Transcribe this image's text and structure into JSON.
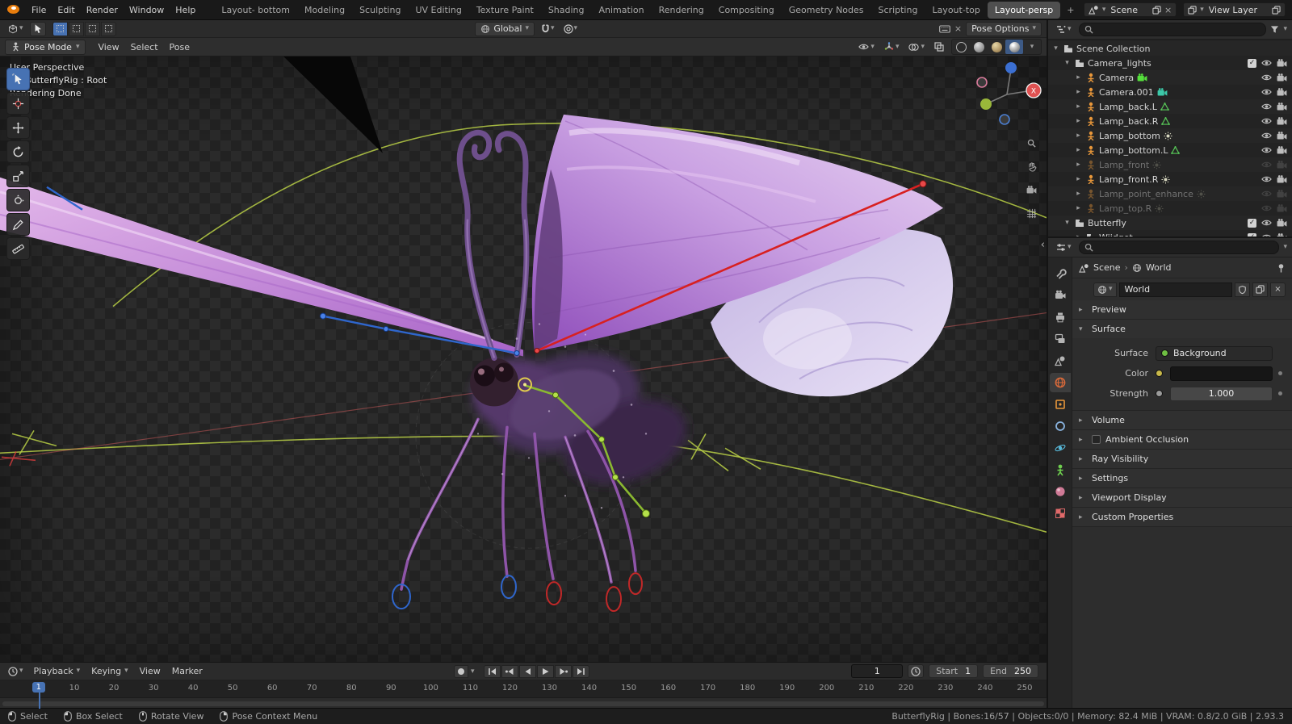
{
  "icons": {
    "dropdown": "▾",
    "disclosure_open": "▾",
    "disclosure_closed": "▸",
    "breadcrumb_separator": "›",
    "close": "×",
    "add": "+",
    "check": "✓",
    "sidebar_toggle": "‹"
  },
  "colors": {
    "accent": "#4772b3",
    "bone_red": "#d82020",
    "bone_blue": "#2f66cc",
    "bone_green": "#8ab830",
    "root_yellow": "#e0cb4e",
    "wing_purple": "#b57fd0",
    "ground_green": "#b8cf45"
  },
  "topbar": {
    "menus": [
      "File",
      "Edit",
      "Render",
      "Window",
      "Help"
    ],
    "workspaces": [
      "Layout- bottom",
      "Modeling",
      "Sculpting",
      "UV Editing",
      "Texture Paint",
      "Shading",
      "Animation",
      "Rendering",
      "Compositing",
      "Geometry Nodes",
      "Scripting",
      "Layout-top",
      "Layout-persp"
    ],
    "active_workspace": "Layout-persp",
    "scene_selector_label": "Scene",
    "view_layer_selector_label": "View Layer"
  },
  "tool_settings": {
    "orientation_label": "Global",
    "pose_options_label": "Pose Options",
    "select_modes": [
      "tweak",
      "box",
      "circle",
      "lasso"
    ]
  },
  "viewport_header": {
    "mode_label": "Pose Mode",
    "menus": [
      "View",
      "Select",
      "Pose"
    ]
  },
  "viewport": {
    "info_lines": [
      "User Perspective",
      "(1) ButterflyRig : Root",
      "Rendering Done"
    ],
    "gizmo": {
      "x_label": "X"
    },
    "tools": [
      {
        "name": "select-box",
        "active": true
      },
      {
        "name": "cursor"
      },
      {
        "name": "move"
      },
      {
        "name": "rotate"
      },
      {
        "name": "scale"
      },
      {
        "name": "transform"
      },
      {
        "name": "annotate"
      },
      {
        "name": "measure"
      }
    ],
    "nav_icons": [
      "zoom",
      "hand",
      "camera-view",
      "grid"
    ]
  },
  "outliner": {
    "search_placeholder": "",
    "rows": [
      {
        "name": "Scene Collection",
        "level": 0,
        "disclosure": "open",
        "icon": "collection"
      },
      {
        "name": "Camera_lights",
        "level": 1,
        "disclosure": "open",
        "icon": "collection",
        "checkbox": true,
        "eye": true,
        "cam": true
      },
      {
        "name": "Camera",
        "level": 2,
        "disclosure": "closed",
        "icon": "object",
        "badge": "camera",
        "badge_color": "#55e03c",
        "eye": true,
        "cam": true
      },
      {
        "name": "Camera.001",
        "level": 2,
        "disclosure": "closed",
        "icon": "object",
        "badge": "camera",
        "badge_color": "#3cc8a8",
        "eye": true,
        "cam": true
      },
      {
        "name": "Lamp_back.L",
        "level": 2,
        "disclosure": "closed",
        "icon": "object",
        "badge": "mesh",
        "badge_color": "#58c858",
        "eye": true,
        "cam": true
      },
      {
        "name": "Lamp_back.R",
        "level": 2,
        "disclosure": "closed",
        "icon": "object",
        "badge": "mesh",
        "badge_color": "#58c858",
        "eye": true,
        "cam": true
      },
      {
        "name": "Lamp_bottom",
        "level": 2,
        "disclosure": "closed",
        "icon": "object",
        "badge": "light",
        "badge_color": "#d8d8c0",
        "eye": true,
        "cam": true
      },
      {
        "name": "Lamp_bottom.L",
        "level": 2,
        "disclosure": "closed",
        "icon": "object",
        "badge": "mesh",
        "badge_color": "#58c858",
        "eye": true,
        "cam": true
      },
      {
        "name": "Lamp_front",
        "level": 2,
        "disclosure": "closed",
        "icon": "object",
        "badge": "light",
        "badge_color": "#8a8a7a",
        "dimmed": true,
        "eye": true,
        "cam": true
      },
      {
        "name": "Lamp_front.R",
        "level": 2,
        "disclosure": "closed",
        "icon": "object",
        "badge": "light",
        "badge_color": "#d8d8c0",
        "eye": true,
        "cam": true
      },
      {
        "name": "Lamp_point_enhance",
        "level": 2,
        "disclosure": "closed",
        "icon": "object",
        "badge": "light",
        "badge_color": "#8a8a7a",
        "dimmed": true,
        "eye": true,
        "cam": true
      },
      {
        "name": "Lamp_top.R",
        "level": 2,
        "disclosure": "closed",
        "icon": "object",
        "badge": "light",
        "badge_color": "#8a8a7a",
        "dimmed": true,
        "eye": true,
        "cam": true
      },
      {
        "name": "Butterfly",
        "level": 1,
        "disclosure": "open",
        "icon": "collection",
        "checkbox": true,
        "eye": true,
        "cam": true
      },
      {
        "name": "Wiidget",
        "level": 2,
        "disclosure": "closed",
        "icon": "collection",
        "checkbox": true,
        "eye": true,
        "cam": true
      }
    ]
  },
  "properties": {
    "search_placeholder": "",
    "breadcrumb": {
      "scene": "Scene",
      "world": "World"
    },
    "datablock_name": "World",
    "tabs": [
      {
        "name": "tool",
        "shape": "wrench",
        "color": "#b4b4b4"
      },
      {
        "name": "render",
        "shape": "camera",
        "color": "#b4b4b4"
      },
      {
        "name": "output",
        "shape": "printer",
        "color": "#b4b4b4"
      },
      {
        "name": "view-layer",
        "shape": "layers",
        "color": "#b4b4b4"
      },
      {
        "name": "scene",
        "shape": "scene",
        "color": "#b4b4b4"
      },
      {
        "name": "world",
        "shape": "globe",
        "color": "#d8693a",
        "active": true
      },
      {
        "name": "object",
        "shape": "square",
        "color": "#e8973a"
      },
      {
        "name": "constraints",
        "shape": "ring",
        "color": "#8ab4e0"
      },
      {
        "name": "physics",
        "shape": "orbit",
        "color": "#58b8d8"
      },
      {
        "name": "object-data",
        "shape": "person",
        "color": "#6fcf4f"
      },
      {
        "name": "material",
        "shape": "sphere",
        "color": "#cf7a96"
      },
      {
        "name": "texture",
        "shape": "checker",
        "color": "#e06a6a"
      }
    ],
    "panels": [
      {
        "label": "Preview",
        "expanded": false
      },
      {
        "label": "Surface",
        "expanded": true,
        "fields": [
          {
            "label": "Surface",
            "type": "dropdown",
            "value": "Background",
            "socket_color": "#6fbf43"
          },
          {
            "label": "Color",
            "type": "color",
            "socket_color": "#c8b84a",
            "decorator": true
          },
          {
            "label": "Strength",
            "type": "slider",
            "value": "1.000",
            "socket_color": "#9a9a9a",
            "decorator": true
          }
        ]
      },
      {
        "label": "Volume",
        "expanded": false
      },
      {
        "label": "Ambient Occlusion",
        "expanded": false,
        "checkbox": false
      },
      {
        "label": "Ray Visibility",
        "expanded": false
      },
      {
        "label": "Settings",
        "expanded": false
      },
      {
        "label": "Viewport Display",
        "expanded": false
      },
      {
        "label": "Custom Properties",
        "expanded": false
      }
    ]
  },
  "timeline": {
    "menus": [
      "Playback",
      "Keying",
      "View",
      "Marker"
    ],
    "menus_with_dropdown": [
      "Playback",
      "Keying"
    ],
    "transport": [
      "jump-start",
      "prev-keyframe",
      "play-reverse",
      "play",
      "next-keyframe",
      "jump-end"
    ],
    "current_frame": "1",
    "start_label": "Start",
    "start_value": "1",
    "end_label": "End",
    "end_value": "250",
    "playhead_frame": 1,
    "ticks": [
      10,
      20,
      30,
      40,
      50,
      60,
      70,
      80,
      90,
      100,
      110,
      120,
      130,
      140,
      150,
      160,
      170,
      180,
      190,
      200,
      210,
      220,
      230,
      240,
      250
    ]
  },
  "statusbar": {
    "hints": [
      {
        "icon": "mouse-left",
        "label": "Select"
      },
      {
        "icon": "mouse-left-drag",
        "label": "Box Select"
      },
      {
        "icon": "mouse-middle",
        "label": "Rotate View"
      },
      {
        "icon": "mouse-right",
        "label": "Pose Context Menu"
      }
    ],
    "info": "ButterflyRig | Bones:16/57 | Objects:0/0 | Memory: 82.4 MiB | VRAM: 0.8/2.0 GiB | 2.93.3"
  }
}
